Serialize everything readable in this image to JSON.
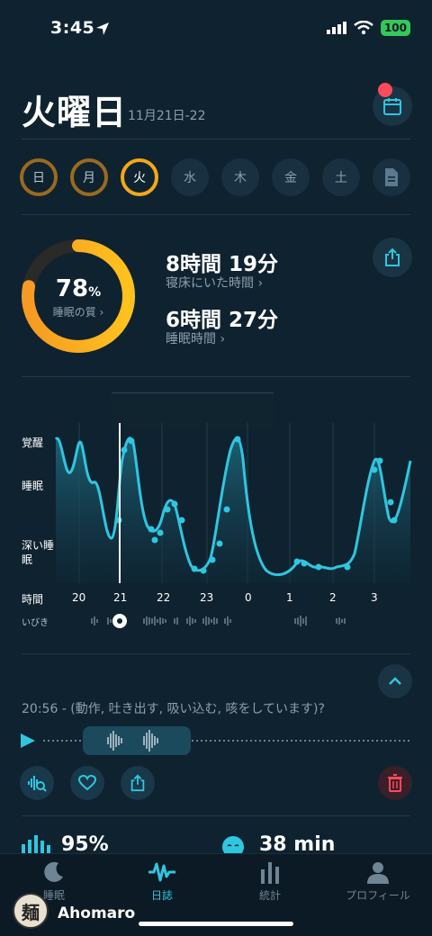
{
  "status": {
    "time": "3:45",
    "battery": "100"
  },
  "header": {
    "title": "火曜日",
    "date_range": "11月21日-22"
  },
  "days": [
    {
      "label": "日",
      "state": "ring"
    },
    {
      "label": "月",
      "state": "ring"
    },
    {
      "label": "火",
      "state": "active"
    },
    {
      "label": "水",
      "state": "empty"
    },
    {
      "label": "木",
      "state": "empty"
    },
    {
      "label": "金",
      "state": "empty"
    },
    {
      "label": "土",
      "state": "empty"
    }
  ],
  "score": {
    "value": "78",
    "unit": "%",
    "label": "睡眠の質 ›",
    "fraction": 0.78,
    "time_in_bed": "8時間 19分",
    "time_in_bed_label": "寝床にいた時間 ›",
    "sleep_time": "6時間 27分",
    "sleep_time_label": "睡眠時間 ›"
  },
  "chart_data": {
    "type": "line",
    "y_categories": [
      "覚醒",
      "睡眠",
      "深い睡眠"
    ],
    "x_axis_label": "時間",
    "x_ticks": [
      "20",
      "21",
      "22",
      "23",
      "0",
      "1",
      "2",
      "3"
    ],
    "snore_label": "いびき",
    "accent": "#2fc6e0"
  },
  "event": {
    "text": "20:56 - (動作, 吐き出す, 吸い込む, 咳をしています)?"
  },
  "bottom": {
    "stat1": "95%",
    "stat2": "38 min"
  },
  "nav": [
    {
      "label": "睡眠"
    },
    {
      "label": "日誌"
    },
    {
      "label": "統計"
    },
    {
      "label": "プロフィール"
    }
  ],
  "user": {
    "name": "Ahomaro",
    "avatar_char": "麺"
  },
  "colors": {
    "background": "#0f2230",
    "accent": "#2fc6e0",
    "score_ring": "#f5a623"
  }
}
